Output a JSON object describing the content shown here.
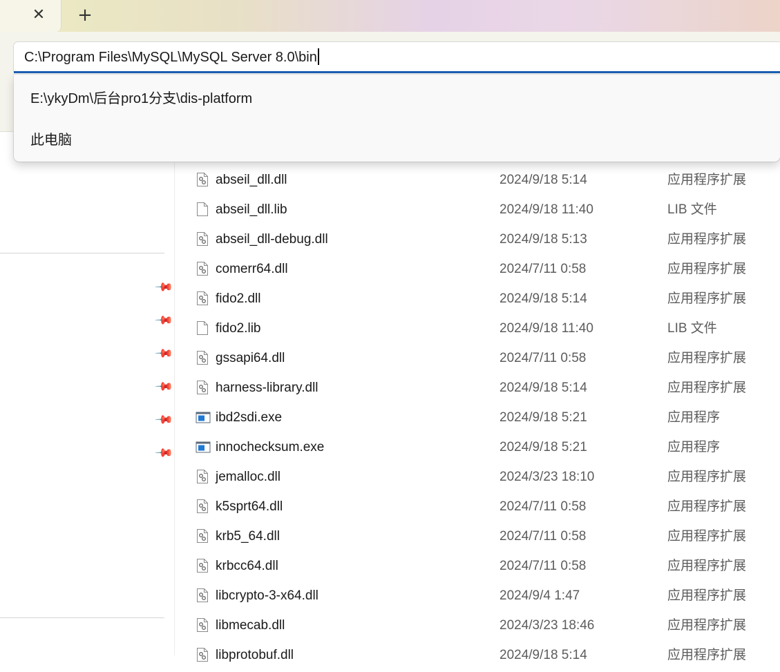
{
  "titlebar": {
    "tab_close_glyph": "✕",
    "new_tab_glyph": "+"
  },
  "address_bar": {
    "value": "C:\\Program Files\\MySQL\\MySQL Server 8.0\\bin"
  },
  "suggestions": [
    {
      "label": "E:\\ykyDm\\后台pro1分支\\dis-platform"
    },
    {
      "label": "此电脑"
    }
  ],
  "sidebar": {
    "pin_glyph": "📌",
    "pinned_count": 6
  },
  "files": [
    {
      "name": "abseil_dll.dll",
      "date": "2024/9/18 5:14",
      "type": "应用程序扩展",
      "icon": "dll-icon"
    },
    {
      "name": "abseil_dll.lib",
      "date": "2024/9/18 11:40",
      "type": "LIB 文件",
      "icon": "file-icon"
    },
    {
      "name": "abseil_dll-debug.dll",
      "date": "2024/9/18 5:13",
      "type": "应用程序扩展",
      "icon": "dll-icon"
    },
    {
      "name": "comerr64.dll",
      "date": "2024/7/11 0:58",
      "type": "应用程序扩展",
      "icon": "dll-icon"
    },
    {
      "name": "fido2.dll",
      "date": "2024/9/18 5:14",
      "type": "应用程序扩展",
      "icon": "dll-icon"
    },
    {
      "name": "fido2.lib",
      "date": "2024/9/18 11:40",
      "type": "LIB 文件",
      "icon": "file-icon"
    },
    {
      "name": "gssapi64.dll",
      "date": "2024/7/11 0:58",
      "type": "应用程序扩展",
      "icon": "dll-icon"
    },
    {
      "name": "harness-library.dll",
      "date": "2024/9/18 5:14",
      "type": "应用程序扩展",
      "icon": "dll-icon"
    },
    {
      "name": "ibd2sdi.exe",
      "date": "2024/9/18 5:21",
      "type": "应用程序",
      "icon": "exe-icon"
    },
    {
      "name": "innochecksum.exe",
      "date": "2024/9/18 5:21",
      "type": "应用程序",
      "icon": "exe-icon"
    },
    {
      "name": "jemalloc.dll",
      "date": "2024/3/23 18:10",
      "type": "应用程序扩展",
      "icon": "dll-icon"
    },
    {
      "name": "k5sprt64.dll",
      "date": "2024/7/11 0:58",
      "type": "应用程序扩展",
      "icon": "dll-icon"
    },
    {
      "name": "krb5_64.dll",
      "date": "2024/7/11 0:58",
      "type": "应用程序扩展",
      "icon": "dll-icon"
    },
    {
      "name": "krbcc64.dll",
      "date": "2024/7/11 0:58",
      "type": "应用程序扩展",
      "icon": "dll-icon"
    },
    {
      "name": "libcrypto-3-x64.dll",
      "date": "2024/9/4 1:47",
      "type": "应用程序扩展",
      "icon": "dll-icon"
    },
    {
      "name": "libmecab.dll",
      "date": "2024/3/23 18:46",
      "type": "应用程序扩展",
      "icon": "dll-icon"
    },
    {
      "name": "libprotobuf.dll",
      "date": "2024/9/18 5:14",
      "type": "应用程序扩展",
      "icon": "dll-icon"
    }
  ]
}
